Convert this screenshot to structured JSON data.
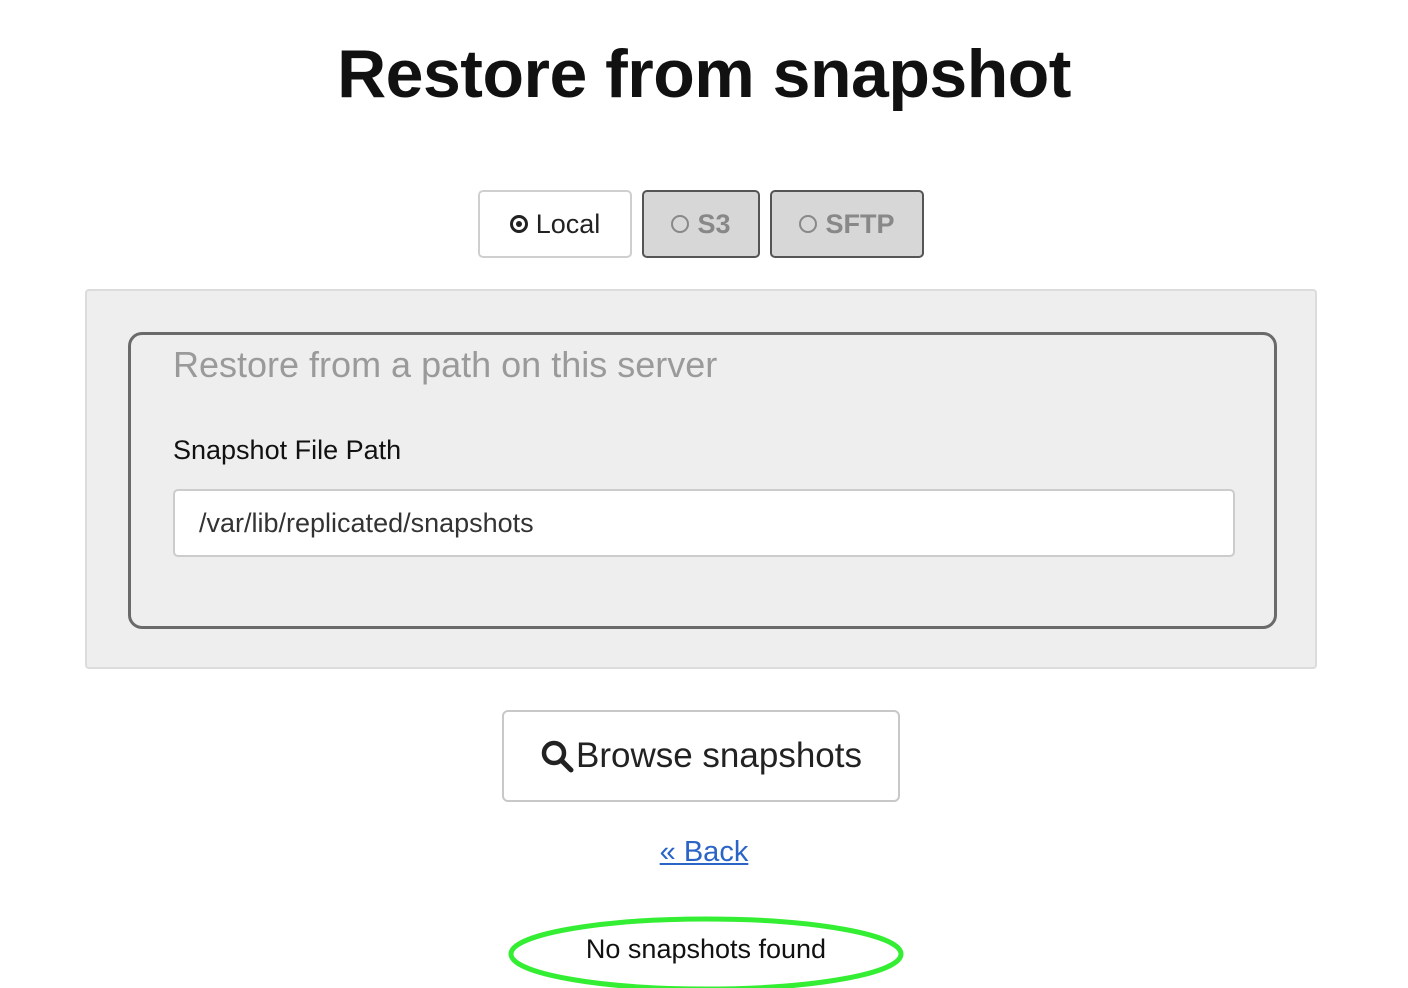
{
  "page": {
    "title": "Restore from snapshot"
  },
  "source_tabs": [
    {
      "label": "Local",
      "selected": true
    },
    {
      "label": "S3",
      "selected": false
    },
    {
      "label": "SFTP",
      "selected": false
    }
  ],
  "local_panel": {
    "legend": "Restore from a path on this server",
    "field_label": "Snapshot File Path",
    "path_value": "/var/lib/replicated/snapshots",
    "path_placeholder": ""
  },
  "actions": {
    "browse_label": "Browse snapshots",
    "back_label": "« Back"
  },
  "status": {
    "message": "No snapshots found",
    "highlight_color": "#33ee33"
  },
  "icons": {
    "browse": "search-icon"
  }
}
